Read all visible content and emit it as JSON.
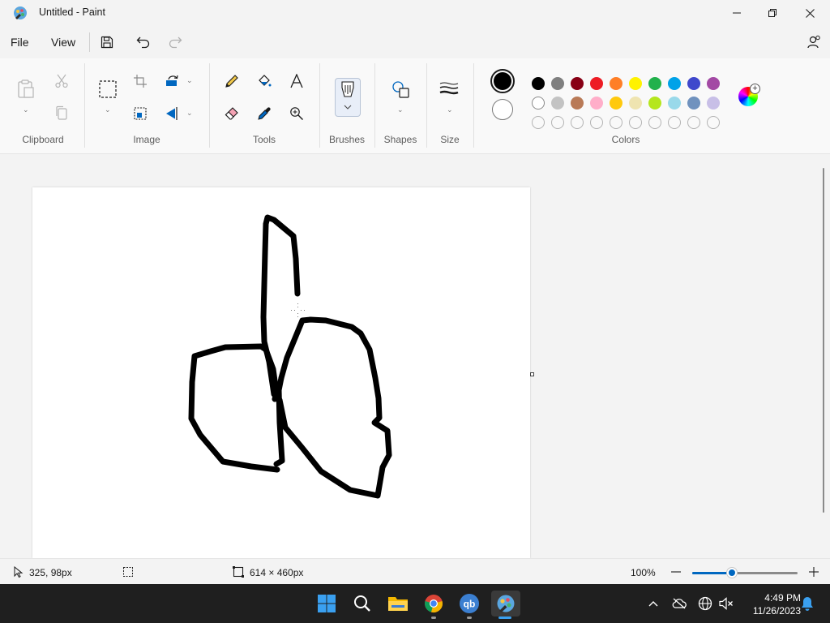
{
  "window": {
    "title": "Untitled - Paint"
  },
  "menu": {
    "file_label": "File",
    "view_label": "View"
  },
  "ribbon": {
    "groups": {
      "clipboard": "Clipboard",
      "image": "Image",
      "tools": "Tools",
      "brushes": "Brushes",
      "shapes": "Shapes",
      "size": "Size",
      "colors": "Colors"
    },
    "icons": {
      "clipboard": [
        "paste-icon",
        "cut-icon",
        "copy-icon"
      ],
      "image": [
        "select-icon",
        "crop-icon",
        "resize-icon",
        "rotate-icon",
        "flip-icon"
      ],
      "tools": [
        "pencil-icon",
        "fill-icon",
        "text-icon",
        "eraser-icon",
        "color-picker-icon",
        "magnifier-icon"
      ]
    }
  },
  "colors": {
    "primary": "#000000",
    "secondary": "#ffffff",
    "palette_row1": [
      "#000000",
      "#7f7f7f",
      "#880015",
      "#ed1c24",
      "#ff7f27",
      "#fff200",
      "#22b14c",
      "#00a2e8",
      "#3f48cc",
      "#a349a4"
    ],
    "palette_row2": [
      "#ffffff",
      "#c3c3c3",
      "#b97a57",
      "#ffaec9",
      "#ffc90e",
      "#efe4b0",
      "#b5e61d",
      "#99d9ea",
      "#7092be",
      "#c8bfe7"
    ],
    "custom_slots": 10
  },
  "canvas": {
    "background": "#ffffff",
    "stroke_color": "#000000"
  },
  "status": {
    "cursor_position": "325, 98px",
    "canvas_size": "614 × 460px",
    "zoom": "100%",
    "zoom_level": 0.38
  },
  "taskbar": {
    "apps": [
      "windows-start-icon",
      "search-icon",
      "file-explorer-icon",
      "chrome-icon",
      "qbittorrent-icon",
      "paint-icon"
    ],
    "qb_label": "qb",
    "time": "4:49 PM",
    "date": "11/26/2023"
  }
}
